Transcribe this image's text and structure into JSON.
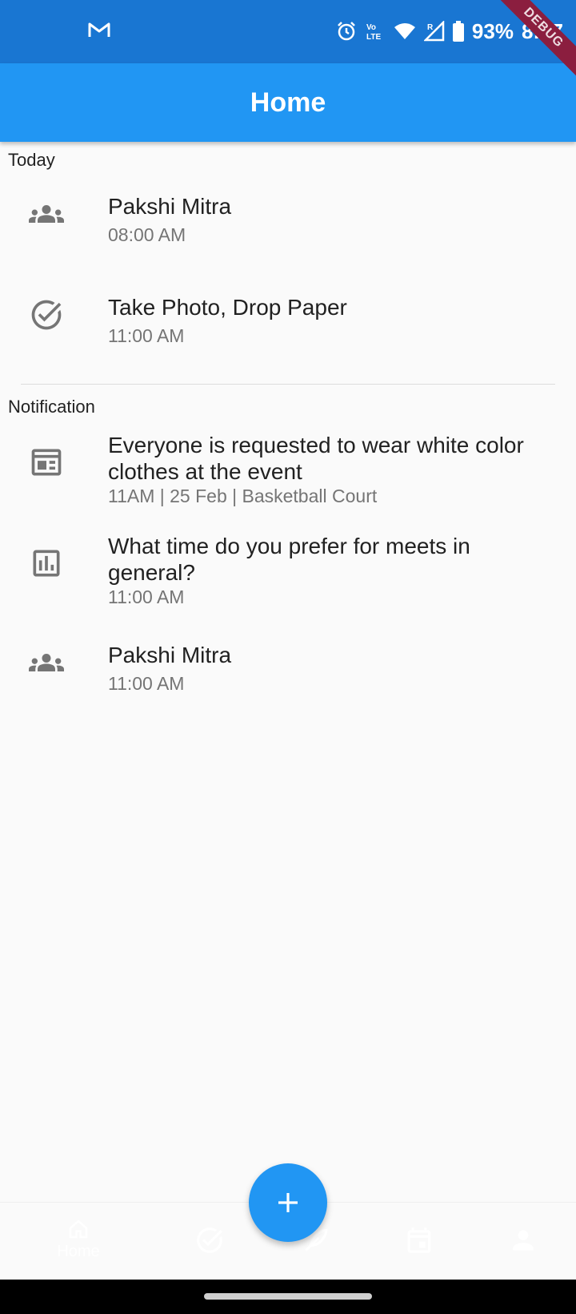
{
  "status_bar": {
    "battery": "93%",
    "time": "8:37",
    "debug_label": "DEBUG",
    "icons": [
      "gmail-icon",
      "alarm-icon",
      "volte-icon",
      "wifi-icon",
      "signal-icon",
      "battery-icon"
    ]
  },
  "app_bar": {
    "title": "Home"
  },
  "sections": {
    "today": {
      "header": "Today",
      "items": [
        {
          "icon": "people-icon",
          "title": "Pakshi Mitra",
          "subtitle": "08:00 AM"
        },
        {
          "icon": "check-circle-icon",
          "title": "Take Photo, Drop Paper",
          "subtitle": "11:00 AM"
        }
      ]
    },
    "notification": {
      "header": "Notification",
      "items": [
        {
          "icon": "event-card-icon",
          "title": "Everyone is requested to wear white color clothes at the event",
          "subtitle": "11AM | 25 Feb | Basketball Court"
        },
        {
          "icon": "poll-icon",
          "title": "What time do you prefer for meets in general?",
          "subtitle": "11:00 AM"
        },
        {
          "icon": "people-icon",
          "title": "Pakshi Mitra",
          "subtitle": "11:00 AM"
        }
      ]
    }
  },
  "bottom_nav": {
    "items": [
      {
        "icon": "home-icon",
        "label": "Home"
      },
      {
        "icon": "check-circle-icon",
        "label": ""
      },
      {
        "icon": "feather-icon",
        "label": ""
      },
      {
        "icon": "calendar-icon",
        "label": ""
      },
      {
        "icon": "person-icon",
        "label": ""
      }
    ]
  },
  "fab": {
    "icon": "plus-icon"
  },
  "colors": {
    "primary": "#2196f3",
    "status_bar": "#1976d2",
    "background": "#fafafa",
    "icon_grey": "#757575",
    "debug_banner": "#8b1e3f"
  }
}
